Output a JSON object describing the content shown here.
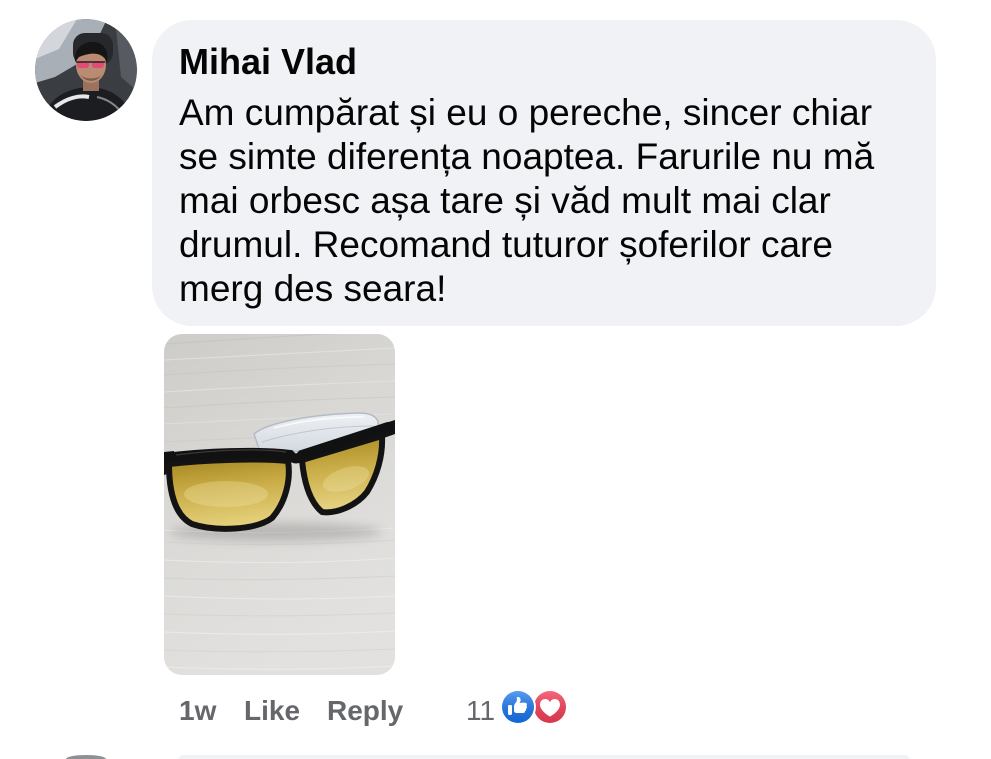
{
  "comment": {
    "author": "Mihai Vlad",
    "text_lines": [
      "Am cumpărat și eu o pereche, sincer chiar",
      "se simte diferența noaptea. Farurile nu mă",
      "mai orbesc așa tare și văd mult mai clar",
      "drumul. Recomand tuturor șoferilor care",
      "merg des seara!"
    ],
    "timestamp": "1w",
    "actions": {
      "like": "Like",
      "reply": "Reply"
    },
    "reactions": {
      "count": "11",
      "icons": [
        "like-icon",
        "love-icon"
      ]
    }
  },
  "colors": {
    "bubble_bg": "#f0f2f5",
    "primary_text": "#050505",
    "secondary_text": "#65676b",
    "like_blue": "#1877f2",
    "love_red": "#f33e58"
  }
}
